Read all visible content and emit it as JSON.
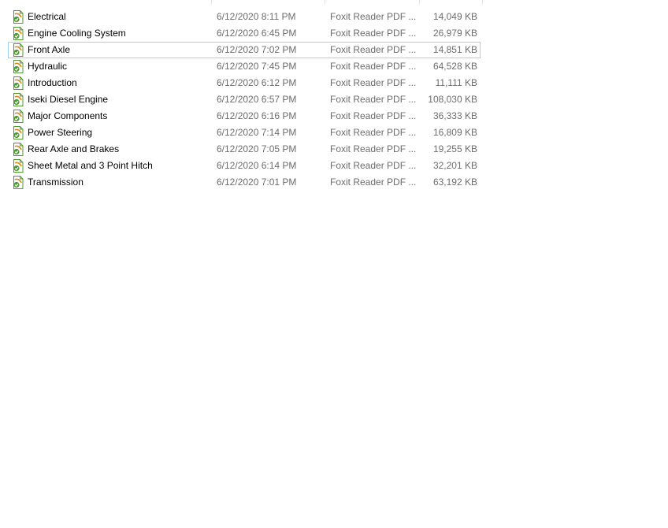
{
  "icon_name": "foxit-pdf-icon",
  "colors": {
    "focus_border": "#99d1ff",
    "secondary_text": "#6d6d6d",
    "icon_green": "#4e9a2f",
    "icon_orange": "#e0871b"
  },
  "files": [
    {
      "name": "Electrical",
      "date": "6/12/2020 8:11 PM",
      "type": "Foxit Reader PDF ...",
      "size": "14,049 KB",
      "focused": false
    },
    {
      "name": "Engine Cooling System",
      "date": "6/12/2020 6:45 PM",
      "type": "Foxit Reader PDF ...",
      "size": "26,979 KB",
      "focused": false
    },
    {
      "name": "Front Axle",
      "date": "6/12/2020 7:02 PM",
      "type": "Foxit Reader PDF ...",
      "size": "14,851 KB",
      "focused": true
    },
    {
      "name": "Hydraulic",
      "date": "6/12/2020 7:45 PM",
      "type": "Foxit Reader PDF ...",
      "size": "64,528 KB",
      "focused": false
    },
    {
      "name": "Introduction",
      "date": "6/12/2020 6:12 PM",
      "type": "Foxit Reader PDF ...",
      "size": "11,111 KB",
      "focused": false
    },
    {
      "name": "Iseki Diesel Engine",
      "date": "6/12/2020 6:57 PM",
      "type": "Foxit Reader PDF ...",
      "size": "108,030 KB",
      "focused": false
    },
    {
      "name": "Major Components",
      "date": "6/12/2020 6:16 PM",
      "type": "Foxit Reader PDF ...",
      "size": "36,333 KB",
      "focused": false
    },
    {
      "name": "Power Steering",
      "date": "6/12/2020 7:14 PM",
      "type": "Foxit Reader PDF ...",
      "size": "16,809 KB",
      "focused": false
    },
    {
      "name": "Rear Axle and Brakes",
      "date": "6/12/2020 7:05 PM",
      "type": "Foxit Reader PDF ...",
      "size": "19,255 KB",
      "focused": false
    },
    {
      "name": "Sheet Metal and 3 Point Hitch",
      "date": "6/12/2020 6:14 PM",
      "type": "Foxit Reader PDF ...",
      "size": "32,201 KB",
      "focused": false
    },
    {
      "name": "Transmission",
      "date": "6/12/2020 7:01 PM",
      "type": "Foxit Reader PDF ...",
      "size": "63,192 KB",
      "focused": false
    }
  ]
}
